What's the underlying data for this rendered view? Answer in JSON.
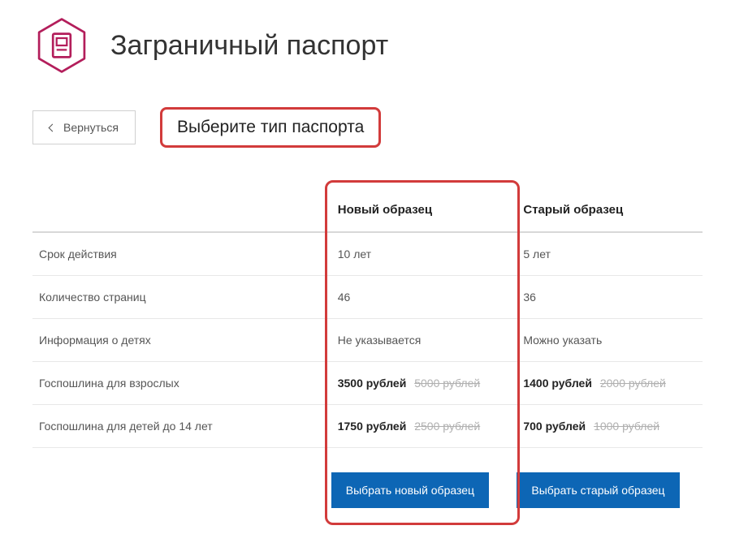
{
  "header": {
    "title": "Заграничный паспорт"
  },
  "controls": {
    "back_label": "Вернуться",
    "section_title": "Выберите тип паспорта"
  },
  "columns": {
    "new": "Новый образец",
    "old": "Старый образец"
  },
  "rows": [
    {
      "label": "Срок действия",
      "new_value": "10 лет",
      "old_value": "5 лет"
    },
    {
      "label": "Количество страниц",
      "new_value": "46",
      "old_value": "36"
    },
    {
      "label": "Информация о детях",
      "new_value": "Не указывается",
      "old_value": "Можно указать"
    }
  ],
  "fees": [
    {
      "label": "Госпошлина для взрослых",
      "new_price": "3500 рублей",
      "new_strike": "5000 рублей",
      "old_price": "1400 рублей",
      "old_strike": "2000 рублей"
    },
    {
      "label": "Госпошлина для детей до 14 лет",
      "new_price": "1750 рублей",
      "new_strike": "2500 рублей",
      "old_price": "700 рублей",
      "old_strike": "1000 рублей"
    }
  ],
  "buttons": {
    "choose_new": "Выбрать новый образец",
    "choose_old": "Выбрать старый образец"
  },
  "colors": {
    "highlight": "#d23b3b",
    "primary_button": "#0d66b5",
    "icon": "#b31e5b"
  }
}
